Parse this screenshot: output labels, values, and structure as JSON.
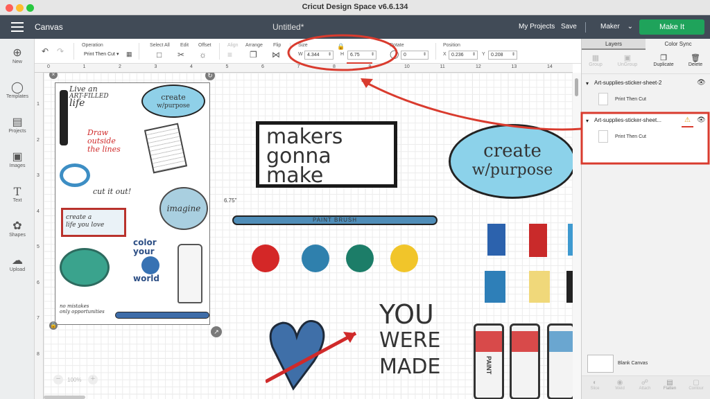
{
  "window": {
    "title": "Cricut Design Space  v6.6.134"
  },
  "header": {
    "canvas_label": "Canvas",
    "document_title": "Untitled*",
    "my_projects": "My Projects",
    "save": "Save",
    "machine": "Maker",
    "make_it": "Make It"
  },
  "toolbar": {
    "operation": {
      "label": "Operation",
      "value": "Print Then Cut"
    },
    "select_all": "Select All",
    "edit": "Edit",
    "offset": "Offset",
    "align": "Align",
    "arrange": "Arrange",
    "flip": "Flip",
    "size": {
      "label": "Size",
      "w_label": "W",
      "w_value": "4.344",
      "h_label": "H",
      "h_value": "6.75"
    },
    "rotate": {
      "label": "Rotate",
      "value": "0"
    },
    "position": {
      "label": "Position",
      "x_label": "X",
      "x_value": "0.236",
      "y_label": "Y",
      "y_value": "0.208"
    }
  },
  "left_nav": [
    {
      "label": "New",
      "icon": "plus-circle-icon"
    },
    {
      "label": "Templates",
      "icon": "shirt-icon"
    },
    {
      "label": "Projects",
      "icon": "folder-icon"
    },
    {
      "label": "Images",
      "icon": "image-icon"
    },
    {
      "label": "Text",
      "icon": "text-icon"
    },
    {
      "label": "Shapes",
      "icon": "shapes-icon"
    },
    {
      "label": "Upload",
      "icon": "upload-icon"
    }
  ],
  "ruler": {
    "top": [
      "0",
      "1",
      "2",
      "3",
      "4",
      "5",
      "6",
      "7",
      "8",
      "9",
      "10",
      "11",
      "12",
      "13",
      "14"
    ],
    "left": [
      "1",
      "2",
      "3",
      "4",
      "5",
      "6",
      "7",
      "8"
    ]
  },
  "canvas": {
    "height_label": "6.75\"",
    "zoom": "100%",
    "stickers": {
      "live_art": [
        "Live an",
        "ART-FILLED",
        "life"
      ],
      "create_small": [
        "create",
        "w/purpose"
      ],
      "draw_outside": [
        "Draw",
        "outside",
        "the lines"
      ],
      "cut_it_out": "cut it out!",
      "create_life": [
        "create a",
        "life you love"
      ],
      "imagine": "imagine",
      "color_world": [
        "color",
        "your",
        "world"
      ],
      "no_mistakes": [
        "no mistakes",
        "only opportunities"
      ],
      "makers": [
        "makers",
        "gonna",
        "make"
      ],
      "create_large": [
        "create",
        "w/purpose"
      ],
      "paint_brush": "PAINT BRUSH",
      "you_were_made": [
        "YOU",
        "WERE",
        "MADE"
      ],
      "paint": "PAINT"
    }
  },
  "right_panel": {
    "tabs": [
      "Layers",
      "Color Sync"
    ],
    "tools": [
      "Group",
      "UnGroup",
      "Duplicate",
      "Delete"
    ],
    "layers": [
      {
        "name": "Art-supplies-sticker-sheet-2",
        "op": "Print Then Cut"
      },
      {
        "name": "Art-supplies-sticker-sheet...",
        "op": "Print Then Cut",
        "warning": true
      }
    ],
    "blank_canvas": "Blank Canvas",
    "bottom_tools": [
      "Slice",
      "Weld",
      "Attach",
      "Flatten",
      "Contour"
    ]
  },
  "colors": {
    "header": "#414b57",
    "make_it": "#1fa35b",
    "annotation": "#d93b2e"
  }
}
